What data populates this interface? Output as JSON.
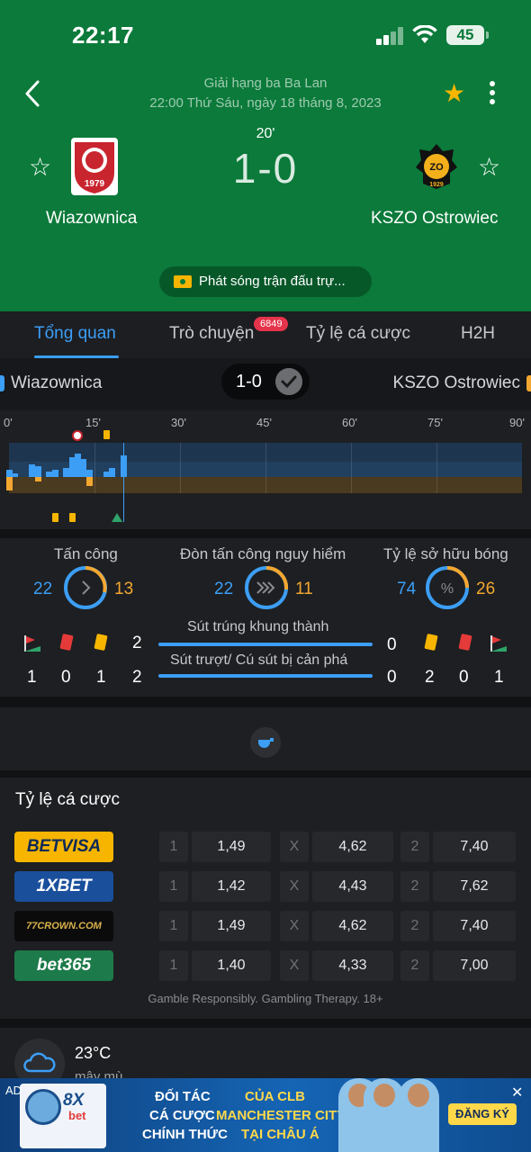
{
  "status_bar": {
    "time": "22:17",
    "battery": "45"
  },
  "match": {
    "league": "Giải hạng ba Ba Lan",
    "datetime": "22:00 Thứ Sáu, ngày 18 tháng 8, 2023",
    "minute": "20'",
    "score": "1-0",
    "home": "Wiazownica",
    "away": "KSZO Ostrowiec",
    "home_logo_text": "1979",
    "away_logo_text": "ZO",
    "away_logo_year": "1929",
    "broadcast": "Phát sóng trận đấu trự..."
  },
  "tabs": [
    {
      "label": "Tổng quan",
      "active": true
    },
    {
      "label": "Trò chuyện",
      "badge": "6849"
    },
    {
      "label": "Tỷ lệ cá cược"
    },
    {
      "label": "H2H"
    }
  ],
  "mini_bar": {
    "home": "Wiazownica",
    "away": "KSZO Ostrowiec",
    "score": "1-0"
  },
  "timeline": {
    "ticks": [
      "0'",
      "15'",
      "30'",
      "45'",
      "60'",
      "75'",
      "90'"
    ],
    "current_minute": 20,
    "home_pressure": [
      8,
      4,
      0,
      0,
      14,
      12,
      0,
      6,
      8,
      0,
      10,
      22,
      26,
      20,
      8,
      0,
      0,
      6,
      10,
      0,
      24
    ],
    "away_pressure": [
      6,
      0,
      0,
      0,
      0,
      2,
      0,
      0,
      0,
      0,
      0,
      0,
      0,
      0,
      4,
      0,
      0,
      0,
      0,
      0,
      0
    ],
    "home_events": [
      {
        "minute": 12,
        "type": "goal"
      },
      {
        "minute": 17,
        "type": "yellow-card"
      }
    ],
    "away_events": [
      {
        "minute": 8,
        "type": "yellow-card"
      },
      {
        "minute": 11,
        "type": "yellow-card"
      },
      {
        "minute": 19,
        "type": "corner"
      }
    ]
  },
  "stats": {
    "attack": {
      "label": "Tấn công",
      "home": "22",
      "away": "13"
    },
    "dangerous": {
      "label": "Đòn tấn công nguy hiểm",
      "home": "22",
      "away": "11"
    },
    "possession": {
      "label": "Tỷ lệ sở hữu bóng",
      "home": "74",
      "away": "26"
    },
    "on_target": {
      "label": "Sút trúng khung thành",
      "home": "2",
      "away": "0"
    },
    "off_target": {
      "label": "Sút trượt/ Cú sút bị cản phá",
      "home": "2",
      "away": "0"
    },
    "home_cards": {
      "corners": "1",
      "red": "0",
      "yellow": "1"
    },
    "away_cards": {
      "yellow": "2",
      "red": "0",
      "corners": "1"
    }
  },
  "odds": {
    "title": "Tỷ lệ cá cược",
    "rows": [
      {
        "bookmaker": "BETVISA",
        "l1": "1",
        "v1": "1,49",
        "lx": "X",
        "vx": "4,62",
        "l2": "2",
        "v2": "7,40",
        "bg": "#f7b500",
        "fg": "#0d2a57"
      },
      {
        "bookmaker": "1XBET",
        "l1": "1",
        "v1": "1,42",
        "lx": "X",
        "vx": "4,43",
        "l2": "2",
        "v2": "7,62",
        "bg": "#1a4f9c",
        "fg": "#ffffff"
      },
      {
        "bookmaker": "77CROWN.COM",
        "l1": "1",
        "v1": "1,49",
        "lx": "X",
        "vx": "4,62",
        "l2": "2",
        "v2": "7,40",
        "bg": "#0b0b0b",
        "fg": "#d9b24a"
      },
      {
        "bookmaker": "bet365",
        "l1": "1",
        "v1": "1,40",
        "lx": "X",
        "vx": "4,33",
        "l2": "2",
        "v2": "7,00",
        "bg": "#1d7a4a",
        "fg": "#ffffff"
      }
    ],
    "disclaimer": "Gamble Responsibly. Gambling Therapy. 18+"
  },
  "weather": {
    "temp": "23°C",
    "condition": "mây mù"
  },
  "ad": {
    "tag": "AD",
    "brand": "8X",
    "brand_sub": "bet",
    "line1": "ĐỐI TÁC",
    "line2": "CÁ CƯỢC",
    "line3": "CHÍNH THỨC",
    "line4": "CỦA CLB",
    "line5": "MANCHESTER CITY",
    "line6": "TẠI CHÂU Á",
    "cta": "ĐĂNG KÝ",
    "close": "✕"
  }
}
